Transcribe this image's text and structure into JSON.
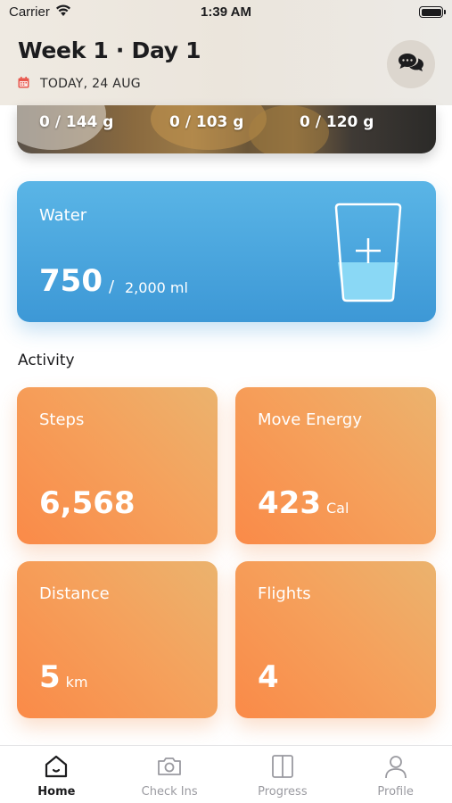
{
  "status_bar": {
    "carrier": "Carrier",
    "time": "1:39 AM"
  },
  "header": {
    "title": "Week 1 · Day 1",
    "date": "TODAY, 24 AUG"
  },
  "macros": [
    {
      "value": "0 / 144 g"
    },
    {
      "value": "0 / 103 g"
    },
    {
      "value": "0 / 120 g"
    }
  ],
  "water": {
    "title": "Water",
    "value": "750",
    "separator": "/",
    "goal": "2,000 ml",
    "fill_fraction": 0.375
  },
  "activity": {
    "title": "Activity",
    "tiles": [
      {
        "label": "Steps",
        "value": "6,568",
        "unit": ""
      },
      {
        "label": "Move Energy",
        "value": "423",
        "unit": "Cal"
      },
      {
        "label": "Distance",
        "value": "5",
        "unit": "km"
      },
      {
        "label": "Flights",
        "value": "4",
        "unit": ""
      }
    ]
  },
  "tab_bar": {
    "active": "Home",
    "tabs": [
      {
        "label": "Home",
        "icon": "home-icon"
      },
      {
        "label": "Check Ins",
        "icon": "camera-icon"
      },
      {
        "label": "Progress",
        "icon": "book-icon"
      },
      {
        "label": "Profile",
        "icon": "person-icon"
      }
    ]
  },
  "colors": {
    "water_card": "#4aa7de",
    "activity_tile": "#f5a15c",
    "calendar_icon": "#e8584e"
  }
}
